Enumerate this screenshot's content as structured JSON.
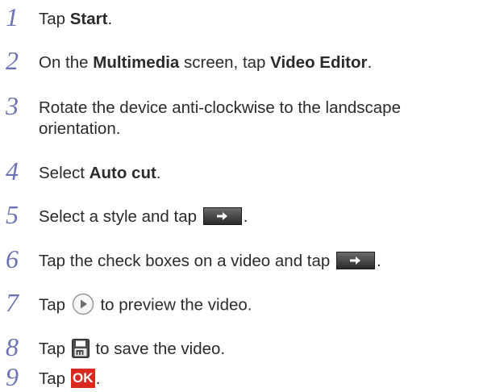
{
  "steps": [
    {
      "number": "1",
      "parts": [
        "Tap ",
        "Start",
        "."
      ]
    },
    {
      "number": "2",
      "parts": [
        "On the ",
        "Multimedia",
        " screen, tap ",
        "Video Editor",
        "."
      ]
    },
    {
      "number": "3",
      "line1": "Rotate the device anti-clockwise to the landscape",
      "line2": "orientation."
    },
    {
      "number": "4",
      "parts": [
        "Select ",
        "Auto cut",
        "."
      ]
    },
    {
      "number": "5",
      "before": "Select a style and tap ",
      "icon": "next-arrow-icon",
      "after": "."
    },
    {
      "number": "6",
      "before": "Tap the check boxes on a video and tap ",
      "icon": "next-arrow-icon",
      "after": "."
    },
    {
      "number": "7",
      "before": "Tap ",
      "icon": "play-icon",
      "after": " to preview the video."
    },
    {
      "number": "8",
      "before": "Tap ",
      "icon": "save-icon",
      "after": " to save the video."
    },
    {
      "number": "9",
      "before": "Tap ",
      "icon_label": "OK",
      "after": "."
    }
  ],
  "colors": {
    "step_number": "#6b73b5",
    "body_text": "#2b2b2b",
    "ok_button": "#d92a1f"
  }
}
